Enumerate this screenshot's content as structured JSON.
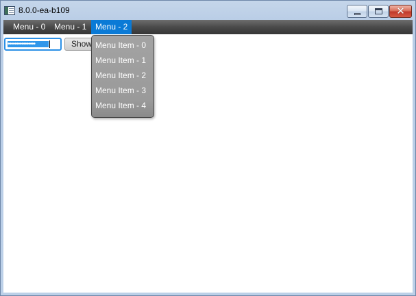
{
  "window": {
    "title": "8.0.0-ea-b109",
    "minimize_icon": "minimize-icon",
    "maximize_icon": "maximize-icon",
    "close_icon": "close-icon",
    "close_glyph": "✕",
    "app_icon": "app-window-icon"
  },
  "menubar": {
    "menus": [
      {
        "label": "Menu - 0"
      },
      {
        "label": "Menu - 1"
      },
      {
        "label": "Menu - 2",
        "active": true
      }
    ]
  },
  "password_field": {
    "masked_value": "••••••••••••••••"
  },
  "show_button": {
    "label": "Show"
  },
  "dropdown": {
    "items": [
      {
        "label": "Menu Item - 0"
      },
      {
        "label": "Menu Item - 1"
      },
      {
        "label": "Menu Item - 2"
      },
      {
        "label": "Menu Item - 3"
      },
      {
        "label": "Menu Item - 4"
      }
    ]
  },
  "colors": {
    "menubar": "#4a4a4a",
    "active_menu": "#0a7ad6",
    "dropdown_bg": "#9a9a9a",
    "focus_border": "#2a8fe6"
  }
}
